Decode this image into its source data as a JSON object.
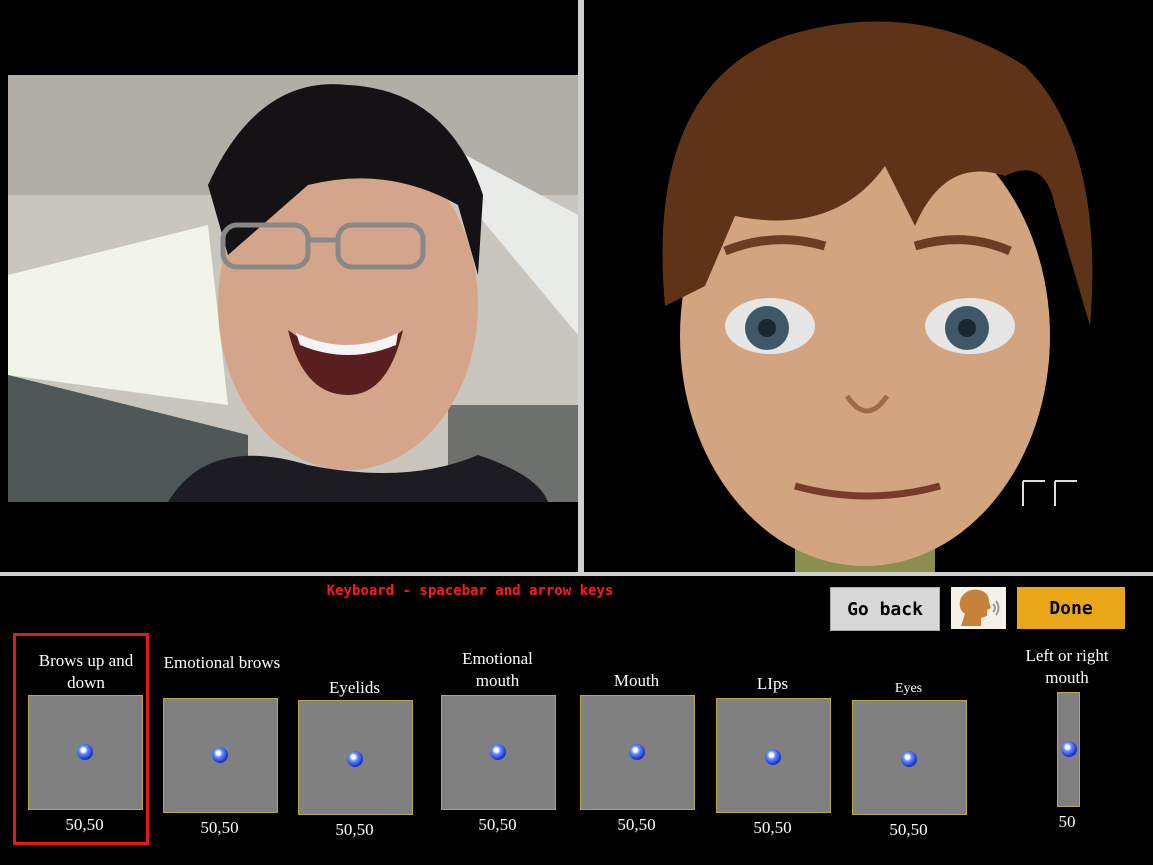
{
  "instruction": "Keyboard - spacebar and arrow keys",
  "buttons": {
    "go_back": "Go back",
    "done": "Done",
    "speak_icon": "speaking-head-icon"
  },
  "controls": [
    {
      "label": "Brows up and down",
      "value": "50,50",
      "selected": true
    },
    {
      "label": "Emotional brows",
      "value": "50,50"
    },
    {
      "label": "Eyelids",
      "value": "50,50"
    },
    {
      "label": "Emotional mouth",
      "value": "50,50"
    },
    {
      "label": "Mouth",
      "value": "50,50"
    },
    {
      "label": "LIps",
      "value": "50,50"
    },
    {
      "label": "Eyes",
      "value": "50,50"
    },
    {
      "label": "Left  or right mouth",
      "value": "50"
    }
  ],
  "colors": {
    "accent_red": "#ff1a1a",
    "done_orange": "#e9a617",
    "pad_gray": "#808080",
    "dot_blue": "#1b3ad0"
  }
}
